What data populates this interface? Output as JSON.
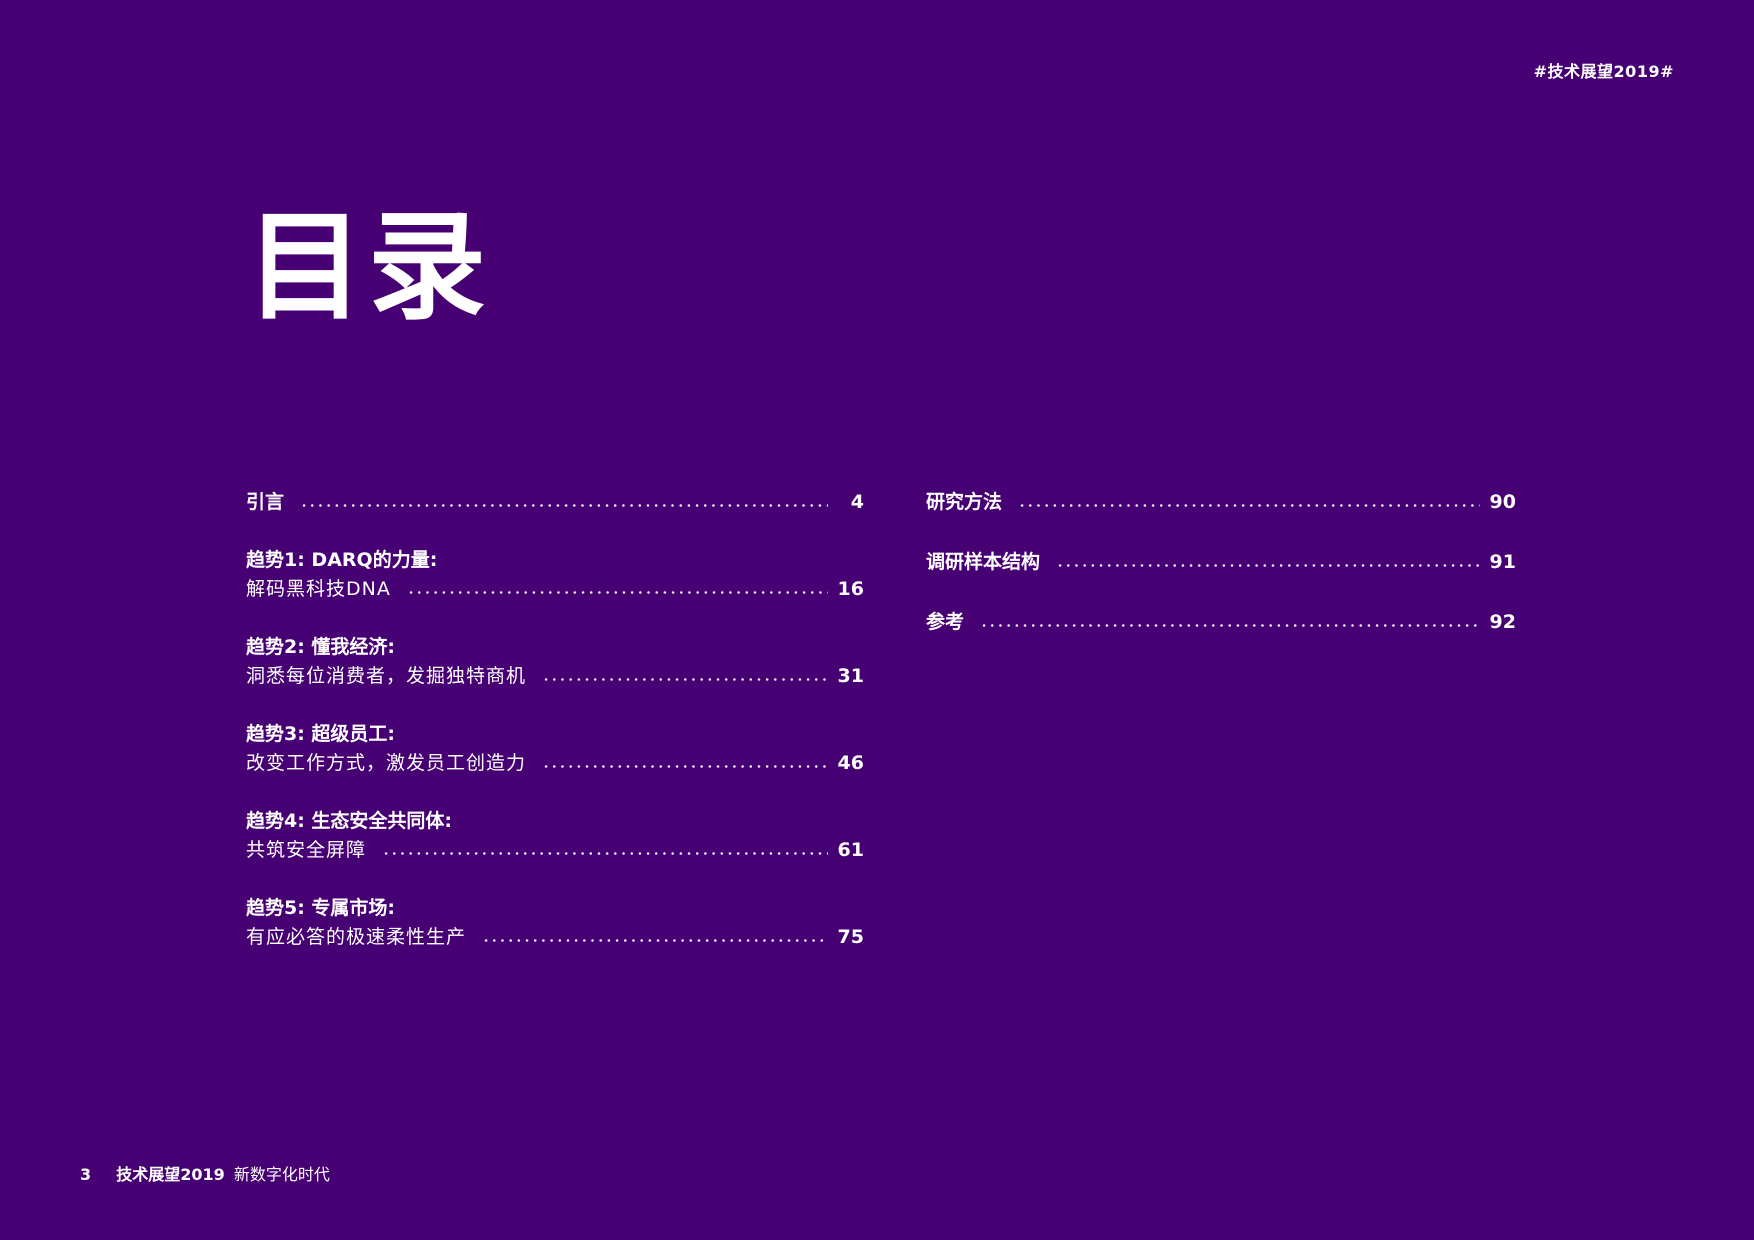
{
  "header": {
    "hashtag": "#技术展望2019#"
  },
  "page_title": "目录",
  "toc_left": [
    {
      "title": "",
      "label": "引言",
      "page": "4"
    },
    {
      "title": "趋势1: DARQ的力量:",
      "label": "解码黑科技DNA",
      "page": "16"
    },
    {
      "title": "趋势2: 懂我经济:",
      "label": "洞悉每位消费者，发掘独特商机",
      "page": "31"
    },
    {
      "title": "趋势3: 超级员工:",
      "label": "改变工作方式，激发员工创造力",
      "page": "46"
    },
    {
      "title": "趋势4: 生态安全共同体:",
      "label": "共筑安全屏障",
      "page": "61"
    },
    {
      "title": "趋势5: 专属市场:",
      "label": "有应必答的极速柔性生产",
      "page": "75"
    }
  ],
  "toc_right": [
    {
      "label": "研究方法",
      "page": "90"
    },
    {
      "label": "调研样本结构",
      "page": "91"
    },
    {
      "label": "参考",
      "page": "92"
    }
  ],
  "footer": {
    "page_number": "3",
    "brand": "技术展望2019",
    "subtitle": "新数字化时代"
  }
}
